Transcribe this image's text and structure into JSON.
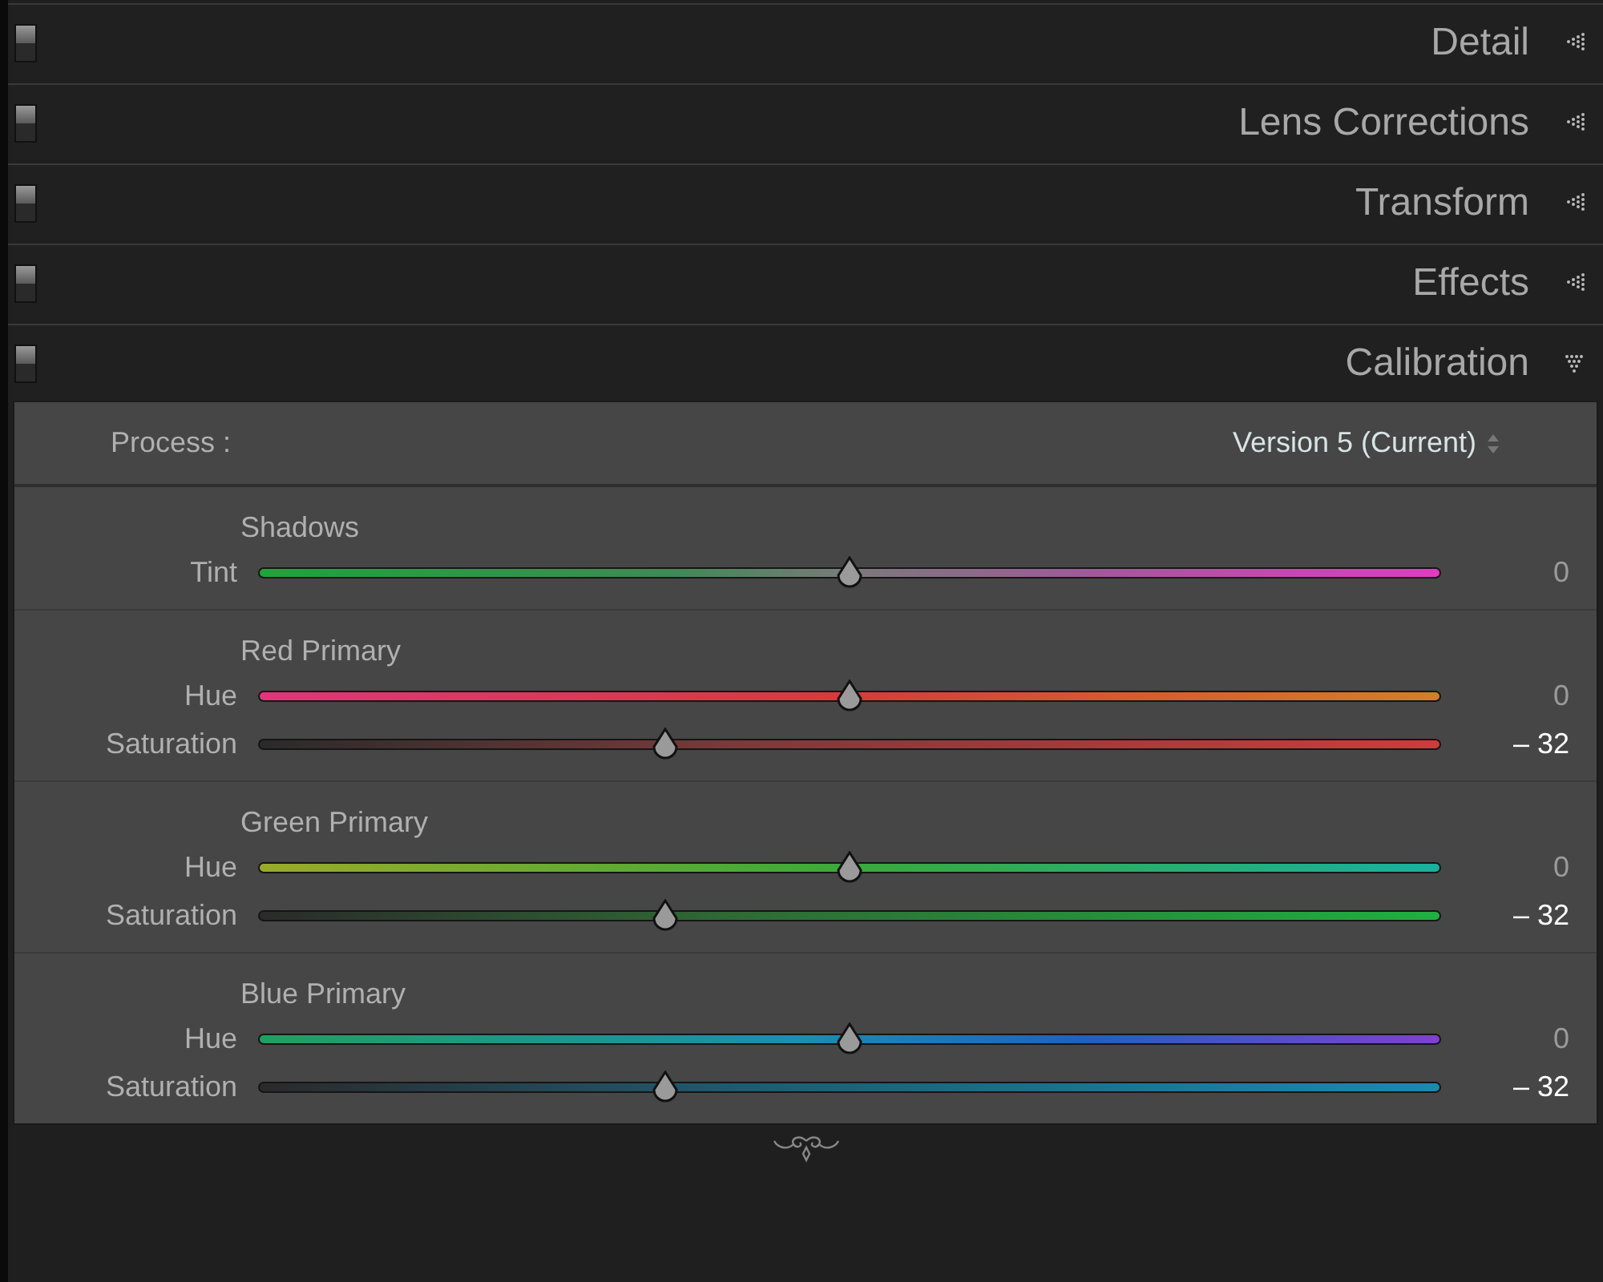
{
  "panels": [
    {
      "title": "Detail",
      "expanded": false
    },
    {
      "title": "Lens Corrections",
      "expanded": false
    },
    {
      "title": "Transform",
      "expanded": false
    },
    {
      "title": "Effects",
      "expanded": false
    },
    {
      "title": "Calibration",
      "expanded": true
    }
  ],
  "process": {
    "label": "Process :",
    "value": "Version 5 (Current)"
  },
  "groups": [
    {
      "title": "Shadows",
      "sliders": [
        {
          "label": "Tint",
          "kind": "tint",
          "level": 0.5,
          "reading": "0"
        }
      ]
    },
    {
      "title": "Red Primary",
      "sliders": [
        {
          "label": "Hue",
          "kind": "redhue",
          "level": 0.5,
          "reading": "0"
        },
        {
          "label": "Saturation",
          "kind": "redsat",
          "level": 0.344,
          "reading": "– 32"
        }
      ]
    },
    {
      "title": "Green Primary",
      "sliders": [
        {
          "label": "Hue",
          "kind": "greenhue",
          "level": 0.5,
          "reading": "0"
        },
        {
          "label": "Saturation",
          "kind": "greensat",
          "level": 0.344,
          "reading": "– 32"
        }
      ]
    },
    {
      "title": "Blue Primary",
      "sliders": [
        {
          "label": "Hue",
          "kind": "bluehue",
          "level": 0.5,
          "reading": "0"
        },
        {
          "label": "Saturation",
          "kind": "bluesat",
          "level": 0.344,
          "reading": "– 32"
        }
      ]
    }
  ]
}
